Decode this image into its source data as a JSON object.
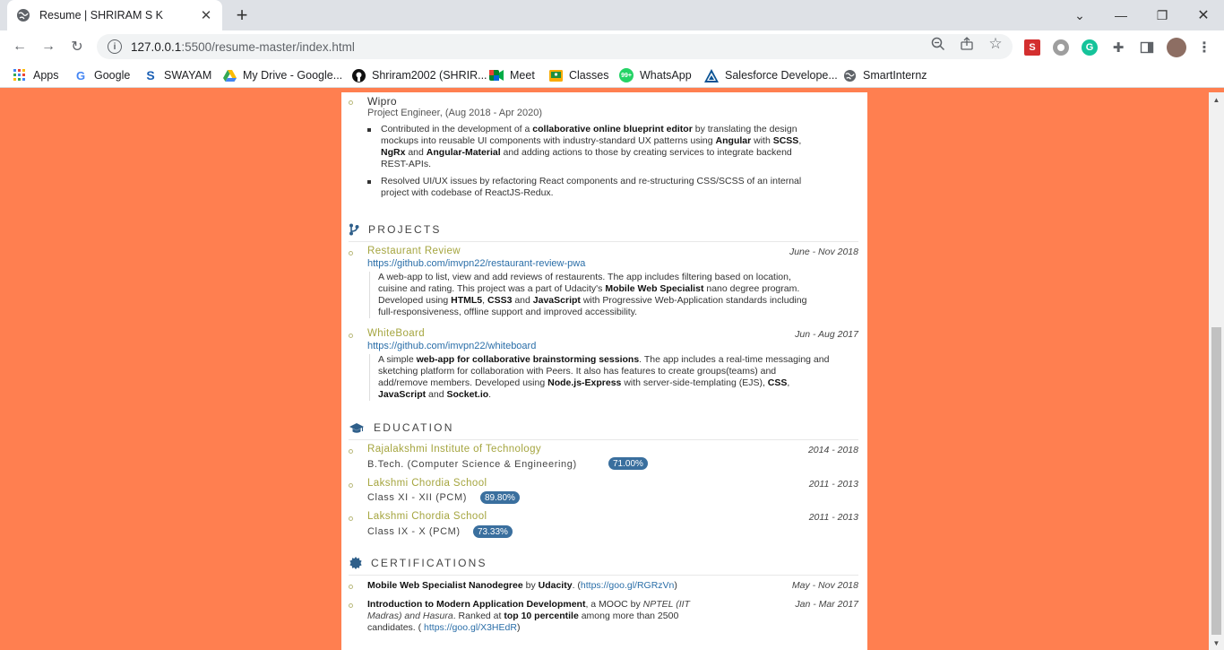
{
  "browser": {
    "tab_title": "Resume | SHRIRAM S K",
    "url_host": "127.0.0.1",
    "url_path": ":5500/resume-master/index.html",
    "bookmarks": [
      {
        "label": "Apps",
        "icon": "apps-grid-icon"
      },
      {
        "label": "Google",
        "icon": "google-icon"
      },
      {
        "label": "SWAYAM",
        "icon": "swayam-icon"
      },
      {
        "label": "My Drive - Google...",
        "icon": "drive-icon"
      },
      {
        "label": "Shriram2002 (SHRIR...",
        "icon": "github-icon"
      },
      {
        "label": "Meet",
        "icon": "meet-icon"
      },
      {
        "label": "Classes",
        "icon": "classroom-icon"
      },
      {
        "label": "WhatsApp",
        "icon": "whatsapp-icon"
      },
      {
        "label": "Salesforce Develope...",
        "icon": "salesforce-icon"
      },
      {
        "label": "SmartInternz",
        "icon": "globe-icon"
      }
    ]
  },
  "resume": {
    "experience": {
      "company": "Wipro",
      "role": "Project Engineer, (Aug 2018 - Apr 2020)",
      "bullet1": {
        "l1a": "Contributed in the development of a ",
        "l1b": "collaborative online blueprint editor",
        "l1c": " by translating the design",
        "l2a": "mockups into reusable UI components with industry-standard UX patterns using ",
        "l2b": "Angular",
        "l2c": " with ",
        "l2d": "SCSS",
        "l2e": ",",
        "l3a": "NgRx",
        "l3b": " and ",
        "l3c": "Angular-Material",
        "l3d": " and adding actions to those by creating services to integrate backend",
        "l4": "REST-APIs."
      },
      "bullet2": {
        "l1": "Resolved UI/UX issues by refactoring React components and re-structuring CSS/SCSS of an internal",
        "l2": "project with codebase of ReactJS-Redux."
      }
    },
    "projects": {
      "title": "PROJECTS",
      "items": [
        {
          "name": "Restaurant Review",
          "date": "June - Nov 2018",
          "link": "https://github.com/imvpn22/restaurant-review-pwa",
          "l1": "A web-app to list, view and add reviews of restaurents. The app includes filtering based on location,",
          "l2a": "cuisine and rating. This project was a part of Udacity's ",
          "l2b": "Mobile Web Specialist",
          "l2c": " nano degree program.",
          "l3a": "Developed using ",
          "l3b": "HTML5",
          "l3c": ", ",
          "l3d": "CSS3",
          "l3e": " and ",
          "l3f": "JavaScript",
          "l3g": " with Progressive Web-Application standards including",
          "l4": "full-responsiveness, offline support and improved accessibility."
        },
        {
          "name": "WhiteBoard",
          "date": "Jun - Aug 2017",
          "link": "https://github.com/imvpn22/whiteboard",
          "l1a": "A simple ",
          "l1b": "web-app for collaborative brainstorming sessions",
          "l1c": ". The app includes a real-time messaging and",
          "l2": "sketching platform for collaboration with Peers. It also has features to create groups(teams) and",
          "l3a": "add/remove members. Developed using ",
          "l3b": "Node.js-Express",
          "l3c": " with server-side-templating (EJS), ",
          "l3d": "CSS",
          "l3e": ",",
          "l4a": "JavaScript",
          "l4b": " and ",
          "l4c": "Socket.io",
          "l4d": "."
        }
      ]
    },
    "education": {
      "title": "EDUCATION",
      "items": [
        {
          "school": "Rajalakshmi Institute of Technology",
          "degree": "B.Tech. (Computer Science & Engineering)",
          "score": "71.00%",
          "date": "2014 - 2018"
        },
        {
          "school": "Lakshmi Chordia School",
          "degree": "Class XI - XII (PCM)",
          "score": "89.80%",
          "date": "2011 - 2013"
        },
        {
          "school": "Lakshmi Chordia School",
          "degree": "Class IX - X (PCM)",
          "score": "73.33%",
          "date": "2011 - 2013"
        }
      ]
    },
    "certifications": {
      "title": "CERTIFICATIONS",
      "c1": {
        "a": "Mobile Web Specialist Nanodegree",
        "b": " by ",
        "c": "Udacity",
        "d": ". (",
        "link": "https://goo.gl/RGRzVn",
        "e": ")",
        "date": "May - Nov 2018"
      },
      "c2": {
        "a": "Introduction to Modern Application Development",
        "b": ", a MOOC by ",
        "c": "NPTEL (IIT",
        "d": "Madras) and Hasura",
        "e": ". Ranked at ",
        "f": "top 10 percentile",
        "g": " among more than 2500",
        "h": "candidates. ( ",
        "link": "https://goo.gl/X3HEdR",
        "i": ")",
        "date": "Jan - Mar 2017"
      }
    }
  },
  "colors": {
    "background": "#ff7f50",
    "accent_olive": "#a5a53f",
    "link_blue": "#2a6ea8",
    "badge_blue": "#3a6f9e"
  }
}
